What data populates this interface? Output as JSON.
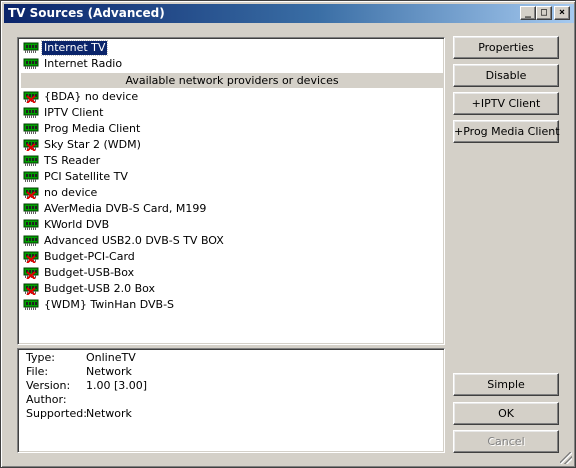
{
  "window": {
    "title": "TV Sources (Advanced)",
    "min_glyph": "_",
    "max_glyph": "□",
    "close_glyph": "×"
  },
  "list": {
    "top_items": [
      {
        "label": "Internet TV",
        "icon": "tuner-card-icon",
        "selected": true,
        "disabled": false
      },
      {
        "label": "Internet Radio",
        "icon": "tuner-card-icon",
        "selected": false,
        "disabled": false
      }
    ],
    "section_header": "Available network providers or devices",
    "devices": [
      {
        "label": "{BDA} no device",
        "disabled": true
      },
      {
        "label": "IPTV Client",
        "disabled": false
      },
      {
        "label": "Prog Media Client",
        "disabled": false
      },
      {
        "label": "Sky Star 2 (WDM)",
        "disabled": true
      },
      {
        "label": "TS Reader",
        "disabled": false
      },
      {
        "label": "PCI Satellite TV",
        "disabled": false
      },
      {
        "label": "no device",
        "disabled": true
      },
      {
        "label": "AVerMedia DVB-S Card, M199",
        "disabled": false
      },
      {
        "label": "KWorld DVB",
        "disabled": false
      },
      {
        "label": "Advanced USB2.0 DVB-S TV BOX",
        "disabled": false
      },
      {
        "label": "Budget-PCI-Card",
        "disabled": true
      },
      {
        "label": "Budget-USB-Box",
        "disabled": true
      },
      {
        "label": "Budget-USB 2.0 Box",
        "disabled": true
      },
      {
        "label": "{WDM} TwinHan DVB-S",
        "disabled": false
      }
    ]
  },
  "info": {
    "type_label": "Type:",
    "type_value": "OnlineTV",
    "file_label": "File:",
    "file_value": "Network",
    "version_label": "Version:",
    "version_value": "1.00 [3.00]",
    "author_label": "Author:",
    "author_value": "",
    "supported_label": "Supported:",
    "supported_value": "Network"
  },
  "buttons": {
    "properties": "Properties",
    "disable": "Disable",
    "add_iptv": "+IPTV Client",
    "add_prog": "+Prog Media Client",
    "simple": "Simple",
    "ok": "OK",
    "cancel": "Cancel",
    "cancel_enabled": false
  },
  "colors": {
    "icon_green": "#00a000",
    "disabled_x": "#e00000",
    "selection": "#0a246a"
  }
}
